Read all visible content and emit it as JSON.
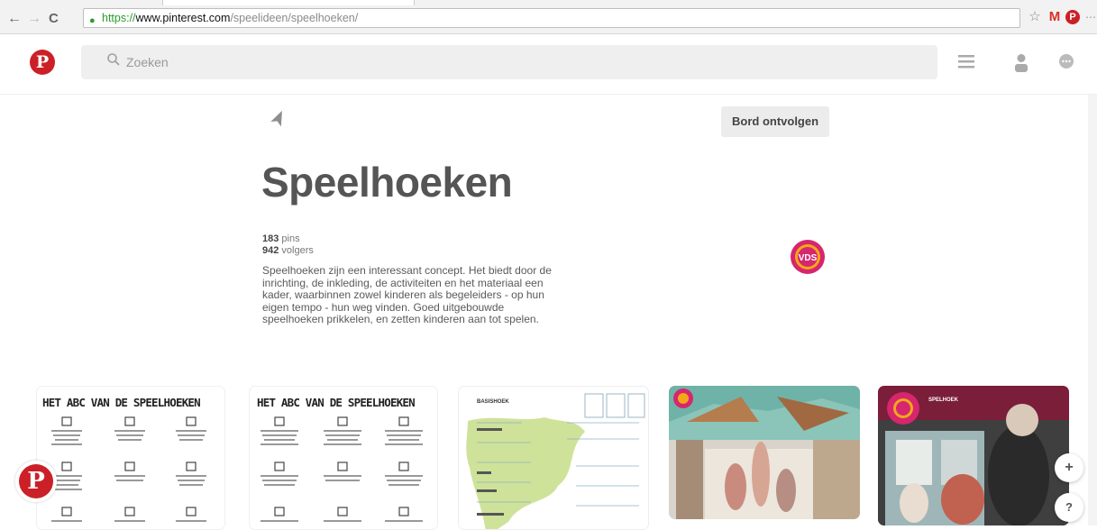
{
  "browser": {
    "url_scheme": "https://",
    "url_host": "www.pinterest.com",
    "url_path": "/speelideen/speelhoeken/",
    "back_label": "←",
    "forward_label": "→",
    "reload_label": "C",
    "lock_label": "🔒",
    "ext_star": "☆",
    "ext_gmail": "M",
    "ext_pinterest": "℗",
    "ext_other": "⋯"
  },
  "header": {
    "logo": "P",
    "search_placeholder": "Zoeken",
    "search_icon": "⚲"
  },
  "board": {
    "title": "Speelhoeken",
    "pins_count": "183",
    "pins_label": "pins",
    "followers_count": "942",
    "followers_label": "volgers",
    "description": "Speelhoeken zijn een interessant concept. Het biedt door de inrichting, de inkleding, de activiteiten en het materiaal een kader, waarbinnen zowel kinderen als begeleiders - op hun eigen tempo - hun weg vinden. Goed uitgebouwde speelhoeken prikkelen, en zetten kinderen aan tot spelen.",
    "follow_button": "Bord ontvolgen",
    "send_icon": "➤"
  },
  "pins": [
    {
      "heading": "HET ABC VAN DE SPEELHOEKEN"
    },
    {
      "heading": "HET ABC VAN DE SPEELHOEKEN"
    },
    {
      "heading": "BASISHOEK"
    },
    {
      "heading": ""
    },
    {
      "heading": "SPELHOEK"
    }
  ],
  "floating": {
    "plus": "+",
    "help": "?"
  },
  "colors": {
    "brand_red": "#cb2027",
    "avatar_pink": "#d6266d"
  }
}
